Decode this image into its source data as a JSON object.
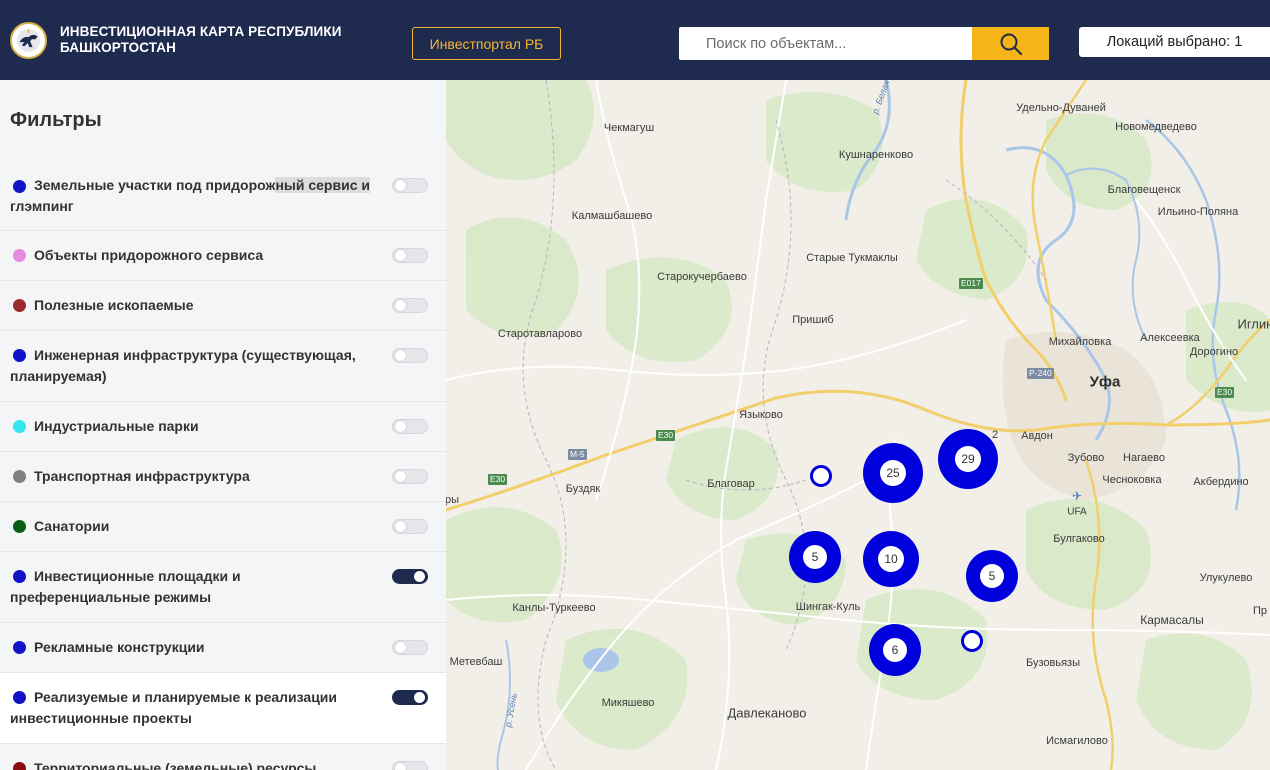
{
  "header": {
    "title": "ИНВЕСТИЦИОННАЯ КАРТА РЕСПУБЛИКИ БАШКОРТОСТАН",
    "portal_button": "Инвестпортал РБ",
    "search_placeholder": "Поиск по объектам...",
    "locations_selected": "Локаций выбрано: 1"
  },
  "sidebar": {
    "title": "Фильтры",
    "filters": [
      {
        "label": "Земельные участки под придорожный сервис и глэмпинг",
        "color": "#1212c8",
        "enabled": false
      },
      {
        "label": "Объекты придорожного сервиса",
        "color": "#e48de0",
        "enabled": false
      },
      {
        "label": "Полезные ископаемые",
        "color": "#9b2a2e",
        "enabled": false
      },
      {
        "label": "Инженерная инфраструктура (существующая, планируемая)",
        "color": "#1212c8",
        "enabled": false
      },
      {
        "label": "Индустриальные парки",
        "color": "#35e6f0",
        "enabled": false
      },
      {
        "label": "Транспортная инфраструктура",
        "color": "#808080",
        "enabled": false
      },
      {
        "label": "Санатории",
        "color": "#0a5d12",
        "enabled": false
      },
      {
        "label": "Инвестиционные площадки и преференциальные режимы",
        "color": "#1212c8",
        "enabled": true
      },
      {
        "label": "Рекламные конструкции",
        "color": "#1212c8",
        "enabled": false
      },
      {
        "label": "Реализуемые и планируемые к реализации инвестиционные проекты",
        "color": "#1212c8",
        "enabled": true
      },
      {
        "label": "Территориальные (земельные) ресурсы",
        "color": "#8b0d10",
        "enabled": false
      }
    ]
  },
  "map": {
    "towns": [
      "Чекмагуш",
      "Кушнаренково",
      "Калмашбашево",
      "Старокучербаево",
      "Старые Тукмаклы",
      "Пришиб",
      "Старотавларово",
      "Языково",
      "Благовар",
      "Буздяк",
      "Шингак-Куль",
      "Канлы-Туркеево",
      "Метевбаш",
      "Микяшево",
      "Давлеканово",
      "Уфа",
      "Удельно-Дуваней",
      "Новомедведево",
      "Благовещенск",
      "Ильино-Поляна",
      "Михайловка",
      "Алексеевка",
      "Дорогино",
      "Иглино",
      "Авдон",
      "Зубово",
      "Нагаево",
      "Чесноковка",
      "Акбердино",
      "UFA",
      "Булгаково",
      "Улукулево",
      "Кармасалы",
      "Бузовьязы",
      "Исмагилово",
      "Пр",
      "ры",
      "2",
      "р. Белая",
      "р. Усень"
    ],
    "roads": [
      "E30",
      "E30",
      "E30",
      "M-5",
      "E017",
      "P-240"
    ],
    "clusters": [
      25,
      29,
      5,
      10,
      5,
      6
    ]
  }
}
